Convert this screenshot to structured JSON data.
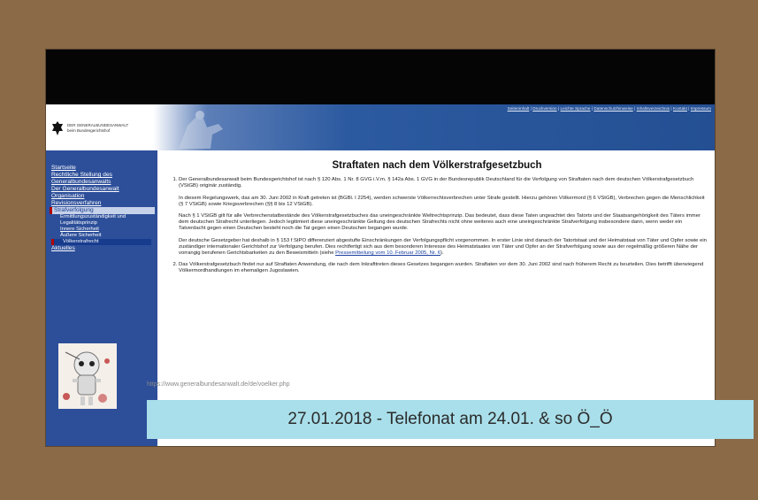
{
  "toplinks": [
    "Seiteninhalt",
    "Druckversion",
    "Leichte Sprache",
    "Datenschutzhinweise",
    "Inhaltsverzeichnis",
    "Kontakt",
    "Impressum"
  ],
  "logo": {
    "line1": "DER GENERALBUNDESANWALT",
    "line2": "beim Bundesgerichtshof"
  },
  "nav": [
    {
      "label": "Startseite",
      "kind": "link"
    },
    {
      "label": "Rechtliche Stellung des Generalbundesanwalts",
      "kind": "link"
    },
    {
      "label": "Der Generalbundesanwalt",
      "kind": "link"
    },
    {
      "label": "Organisation",
      "kind": "link"
    },
    {
      "label": "Revisionsverfahren",
      "kind": "link"
    },
    {
      "label": "Strafverfolgung",
      "kind": "active"
    },
    {
      "label": "Ermittlungszuständigkeit und Legalitätsprinzip",
      "kind": "sub"
    },
    {
      "label": "Innere Sicherheit",
      "kind": "sub"
    },
    {
      "label": "Äußere Sicherheit",
      "kind": "sub"
    },
    {
      "label": "Völkerstrafrecht",
      "kind": "subactive"
    },
    {
      "label": "Aktuelles",
      "kind": "link"
    }
  ],
  "content": {
    "title": "Straftaten nach dem Völkerstrafgesetzbuch",
    "item1_p1": "Der Generalbundesanwalt beim Bundesgerichtshof ist nach § 120 Abs. 1 Nr. 8 GVG i.V.m. § 142a Abs. 1 GVG in der Bundesrepublik Deutschland für die Verfolgung von Straftaten nach dem deutschen Völkerstrafgesetzbuch (VStGB) originär zuständig.",
    "item1_p2": "In diesem Regelungswerk, das am 30. Juni 2002 in Kraft getreten ist (BGBl. I 2254), werden schwerste Völkerrechtsverbrechen unter Strafe gestellt. Hierzu gehören Völkermord (§ 6 VStGB), Verbrechen gegen die Menschlichkeit (§ 7 VStGB) sowie Kriegsverbrechen (§§ 8 bis 12 VStGB).",
    "item1_p3": "Nach § 1 VStGB gilt für alle Verbrechenstatbestände des Völkerstrafgesetzbuches das uneingeschränkte Weltrechtsprinzip. Das bedeutet, dass diese Taten ungeachtet des Tatorts und der Staatsangehörigkeit des Täters immer dem deutschen Strafrecht unterliegen. Jedoch legitimiert diese uneingeschränkte Geltung des deutschen Strafrechts nicht ohne weiteres auch eine uneingeschränkte Strafverfolgung insbesondere dann, wenn weder ein Tatverdacht gegen einen Deutschen besteht noch die Tat gegen einen Deutschen begangen wurde.",
    "item1_p4": "Der deutsche Gesetzgeber hat deshalb in § 153 f StPO differenziert abgestufte Einschränkungen der Verfolgungspflicht vorgenommen. In erster Linie sind danach der Tatortstaat und der Heimatstaat von Täter und Opfer sowie ein zuständiger internationaler Gerichtshof zur Verfolgung berufen. Dies rechtfertigt sich aus dem besonderen Interesse des Heimatstaates von Täter und Opfer an der Strafverfolgung sowie aus der regelmäßig größeren Nähe der vorrangig berufenen Gerichtsbarkeiten zu den Beweismitteln (siehe",
    "item1_link": "Pressemitteilung vom 10. Februar 2005, Nr. 6",
    "item1_tail": ").",
    "item2": "Das Völkerstrafgesetzbuch findet nur auf Straftaten Anwendung, die nach dem Inkrafttreten dieses Gesetzes begangen wurden. Straftaten vor dem 30. Juni 2002 sind nach früherem Recht zu beurteilen. Dies betrifft überwiegend Völkermordhandlungen im ehemaligen Jugoslawien."
  },
  "url": "https://www.generalbundesanwalt.de/de/voelker.php",
  "caption": "27.01.2018 - Telefonat am 24.01. & so Ö_Ö",
  "colors": {
    "background": "#8b6a47",
    "sidebar": "#2d4f9a",
    "caption_bg": "#a9dfea"
  }
}
